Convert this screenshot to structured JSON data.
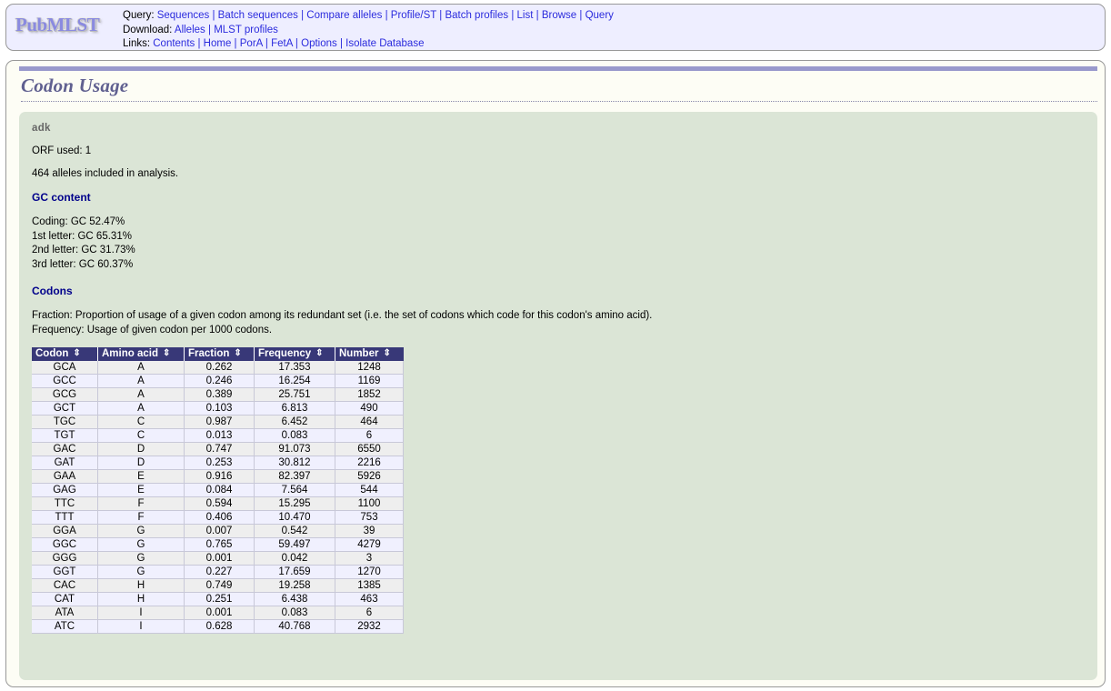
{
  "header": {
    "logo_text": "PubMLST",
    "nav_rows": [
      {
        "label": "Query:",
        "links": [
          "Sequences",
          "Batch sequences",
          "Compare alleles",
          "Profile/ST",
          "Batch profiles",
          "List",
          "Browse",
          "Query"
        ]
      },
      {
        "label": "Download:",
        "links": [
          "Alleles",
          "MLST profiles"
        ]
      },
      {
        "label": "Links:",
        "links": [
          "Contents",
          "Home",
          "PorA",
          "FetA",
          "Options",
          "Isolate Database"
        ]
      }
    ]
  },
  "page": {
    "title": "Codon Usage"
  },
  "results": {
    "locus": "adk",
    "orf_used": "ORF used: 1",
    "alleles_line": "464 alleles included in analysis.",
    "gc_heading": "GC content",
    "gc_lines": [
      "Coding: GC 52.47%",
      "1st letter: GC 65.31%",
      "2nd letter: GC 31.73%",
      "3rd letter: GC 60.37%"
    ],
    "codons_heading": "Codons",
    "legend_lines": [
      "Fraction: Proportion of usage of a given codon among its redundant set (i.e. the set of codons which code for this codon's amino acid).",
      "Frequency: Usage of given codon per 1000 codons."
    ],
    "sort_icon": "⇕",
    "table": {
      "columns": [
        "Codon",
        "Amino acid",
        "Fraction",
        "Frequency",
        "Number"
      ],
      "rows": [
        [
          "GCA",
          "A",
          "0.262",
          "17.353",
          "1248"
        ],
        [
          "GCC",
          "A",
          "0.246",
          "16.254",
          "1169"
        ],
        [
          "GCG",
          "A",
          "0.389",
          "25.751",
          "1852"
        ],
        [
          "GCT",
          "A",
          "0.103",
          "6.813",
          "490"
        ],
        [
          "TGC",
          "C",
          "0.987",
          "6.452",
          "464"
        ],
        [
          "TGT",
          "C",
          "0.013",
          "0.083",
          "6"
        ],
        [
          "GAC",
          "D",
          "0.747",
          "91.073",
          "6550"
        ],
        [
          "GAT",
          "D",
          "0.253",
          "30.812",
          "2216"
        ],
        [
          "GAA",
          "E",
          "0.916",
          "82.397",
          "5926"
        ],
        [
          "GAG",
          "E",
          "0.084",
          "7.564",
          "544"
        ],
        [
          "TTC",
          "F",
          "0.594",
          "15.295",
          "1100"
        ],
        [
          "TTT",
          "F",
          "0.406",
          "10.470",
          "753"
        ],
        [
          "GGA",
          "G",
          "0.007",
          "0.542",
          "39"
        ],
        [
          "GGC",
          "G",
          "0.765",
          "59.497",
          "4279"
        ],
        [
          "GGG",
          "G",
          "0.001",
          "0.042",
          "3"
        ],
        [
          "GGT",
          "G",
          "0.227",
          "17.659",
          "1270"
        ],
        [
          "CAC",
          "H",
          "0.749",
          "19.258",
          "1385"
        ],
        [
          "CAT",
          "H",
          "0.251",
          "6.438",
          "463"
        ],
        [
          "ATA",
          "I",
          "0.001",
          "0.083",
          "6"
        ],
        [
          "ATC",
          "I",
          "0.628",
          "40.768",
          "2932"
        ]
      ]
    }
  },
  "colors": {
    "header_panel_bg": "#eeeeff",
    "main_panel_bg": "#fdfdf5",
    "results_bg": "#dbe5d6",
    "title_rule": "#9999cc",
    "title_text": "#606090",
    "link": "#2b2bdd",
    "section_heading": "#00008b",
    "table_header_bg": "#383878",
    "row_odd": "#eeeeee",
    "row_even": "#f0f0fe"
  }
}
